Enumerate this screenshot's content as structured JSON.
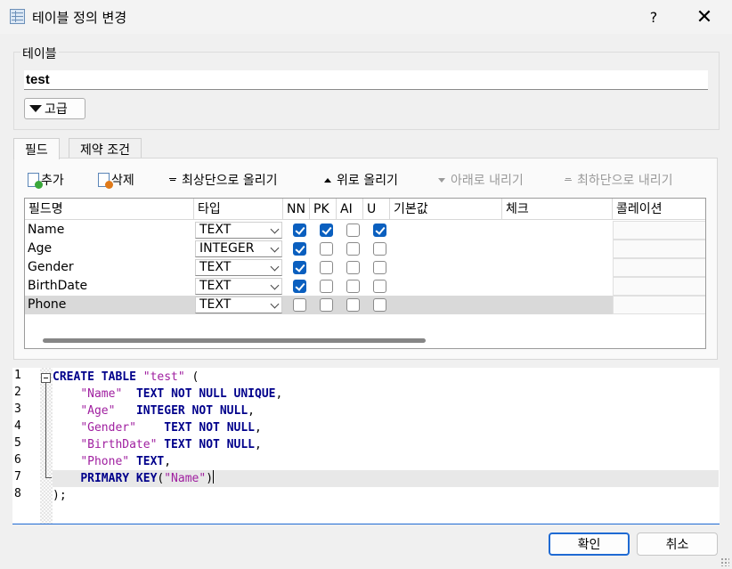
{
  "window": {
    "title": "테이블 정의 변경",
    "help_label": "?",
    "close_label": "✕"
  },
  "table_group": {
    "label": "테이블",
    "name_value": "test",
    "advanced_label": "고급"
  },
  "tabs": [
    {
      "label": "필드",
      "active": true
    },
    {
      "label": "제약 조건",
      "active": false
    }
  ],
  "toolbar": {
    "add_label": "추가",
    "delete_label": "삭제",
    "move_top_label": "최상단으로 올리기",
    "move_up_label": "위로 올리기",
    "move_down_label": "아래로 내리기",
    "move_bottom_label": "최하단으로 내리기"
  },
  "grid": {
    "columns": [
      "필드명",
      "타입",
      "NN",
      "PK",
      "AI",
      "U",
      "기본값",
      "체크",
      "콜레이션"
    ],
    "rows": [
      {
        "name": "Name",
        "type": "TEXT",
        "nn": true,
        "pk": true,
        "ai": false,
        "u": true
      },
      {
        "name": "Age",
        "type": "INTEGER",
        "nn": true,
        "pk": false,
        "ai": false,
        "u": false
      },
      {
        "name": "Gender",
        "type": "TEXT",
        "nn": true,
        "pk": false,
        "ai": false,
        "u": false
      },
      {
        "name": "BirthDate",
        "type": "TEXT",
        "nn": true,
        "pk": false,
        "ai": false,
        "u": false
      },
      {
        "name": "Phone",
        "type": "TEXT",
        "nn": false,
        "pk": false,
        "ai": false,
        "u": false
      }
    ],
    "selected_row": 4
  },
  "sql": {
    "line_numbers": [
      "1",
      "2",
      "3",
      "4",
      "5",
      "6",
      "7",
      "8"
    ],
    "current_line": 7,
    "lines": [
      [
        {
          "t": "CREATE TABLE",
          "c": "kw"
        },
        {
          "t": " "
        },
        {
          "t": "\"test\"",
          "c": "str"
        },
        {
          "t": " ("
        }
      ],
      [
        {
          "t": "    "
        },
        {
          "t": "\"Name\"",
          "c": "str"
        },
        {
          "t": "  "
        },
        {
          "t": "TEXT NOT NULL UNIQUE",
          "c": "kw"
        },
        {
          "t": ","
        }
      ],
      [
        {
          "t": "    "
        },
        {
          "t": "\"Age\"",
          "c": "str"
        },
        {
          "t": "   "
        },
        {
          "t": "INTEGER NOT NULL",
          "c": "kw"
        },
        {
          "t": ","
        }
      ],
      [
        {
          "t": "    "
        },
        {
          "t": "\"Gender\"",
          "c": "str"
        },
        {
          "t": "    "
        },
        {
          "t": "TEXT NOT NULL",
          "c": "kw"
        },
        {
          "t": ","
        }
      ],
      [
        {
          "t": "    "
        },
        {
          "t": "\"BirthDate\"",
          "c": "str"
        },
        {
          "t": " "
        },
        {
          "t": "TEXT NOT NULL",
          "c": "kw"
        },
        {
          "t": ","
        }
      ],
      [
        {
          "t": "    "
        },
        {
          "t": "\"Phone\"",
          "c": "str"
        },
        {
          "t": " "
        },
        {
          "t": "TEXT",
          "c": "kw"
        },
        {
          "t": ","
        }
      ],
      [
        {
          "t": "    "
        },
        {
          "t": "PRIMARY KEY",
          "c": "kw"
        },
        {
          "t": "("
        },
        {
          "t": "\"Name\"",
          "c": "str"
        },
        {
          "t": ")"
        }
      ],
      [
        {
          "t": ");"
        }
      ]
    ]
  },
  "footer": {
    "ok_label": "확인",
    "cancel_label": "취소"
  },
  "colors": {
    "accent": "#1f6ad3",
    "checkbox_checked": "#0a5fbf",
    "sql_keyword": "#00008b",
    "sql_string": "#a020a0",
    "selected_row": "#d9d9d9"
  }
}
